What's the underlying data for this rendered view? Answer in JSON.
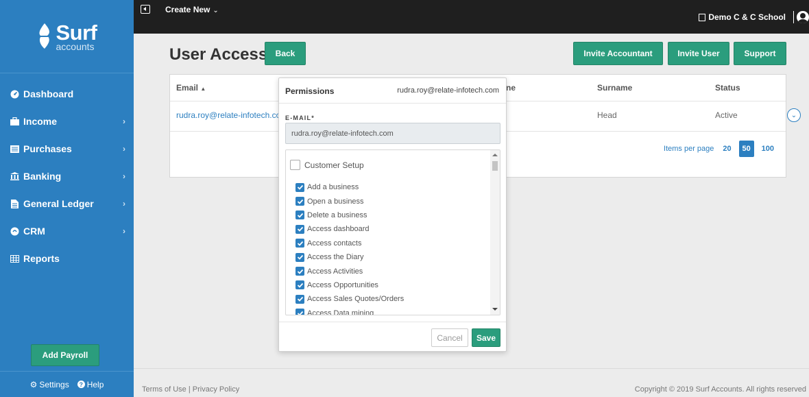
{
  "brand": {
    "name": "Surf",
    "sub": "accounts"
  },
  "sidebar": {
    "items": [
      {
        "label": "Dashboard",
        "icon": "dashboard-icon",
        "chevron": false
      },
      {
        "label": "Income",
        "icon": "briefcase-icon",
        "chevron": true
      },
      {
        "label": "Purchases",
        "icon": "list-icon",
        "chevron": true
      },
      {
        "label": "Banking",
        "icon": "bank-icon",
        "chevron": true
      },
      {
        "label": "General Ledger",
        "icon": "document-icon",
        "chevron": true
      },
      {
        "label": "CRM",
        "icon": "crm-icon",
        "chevron": true
      },
      {
        "label": "Reports",
        "icon": "table-icon",
        "chevron": false
      }
    ],
    "add_payroll": "Add Payroll",
    "settings": "Settings",
    "help": "Help"
  },
  "topbar": {
    "create_new": "Create New",
    "school": "Demo C & C School"
  },
  "page": {
    "title": "User Access",
    "back": "Back",
    "invite_accountant": "Invite Accountant",
    "invite_user": "Invite User",
    "support": "Support"
  },
  "table": {
    "headers": {
      "email": "Email",
      "name_partial": "ne",
      "surname": "Surname",
      "status": "Status"
    },
    "row": {
      "email": "rudra.roy@relate-infotech.co",
      "surname": "Head",
      "status": "Active"
    },
    "items_per_page_label": "Items per page",
    "page_sizes": [
      "20",
      "50",
      "100"
    ],
    "active_page_size": "50"
  },
  "modal": {
    "title": "Permissions",
    "email": "rudra.roy@relate-infotech.com",
    "email_label": "E-MAIL*",
    "email_value": "rudra.roy@relate-infotech.com",
    "group": "Customer Setup",
    "permissions": [
      "Add a business",
      "Open a business",
      "Delete a business",
      "Access dashboard",
      "Access contacts",
      "Access the Diary",
      "Access Activities",
      "Access Opportunities",
      "Access Sales Quotes/Orders",
      "Access Data mining"
    ],
    "cancel": "Cancel",
    "save": "Save"
  },
  "footer": {
    "links": "Terms of Use | Privacy Policy",
    "copyright": "Copyright © 2019 Surf Accounts. All rights reserved"
  },
  "colors": {
    "sidebar": "#2c7fc0",
    "accent": "#2b9d7d",
    "topbar": "#1f1f1f"
  }
}
